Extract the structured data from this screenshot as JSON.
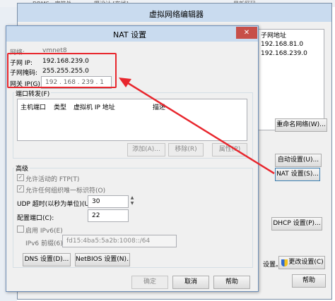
{
  "taskbar": {
    "items": [
      "DRMS - 字符处",
      "摄设计 [在线]",
      "最新区码"
    ]
  },
  "back_window": {
    "title": "虚拟网络编辑器",
    "col_subnet": "子网地址",
    "rows": [
      "192.168.81.0",
      "192.168.239.0"
    ],
    "rename_btn": "重命名网络(W)...",
    "auto_btn": "自动设置(U)...",
    "nat_btn": "NAT 设置(S)...",
    "dhcp_btn": "DHCP 设置(P)...",
    "change_btn": "更改设置(C)",
    "partial_text": "设置。",
    "help_btn": "帮助"
  },
  "nat": {
    "title": "NAT 设置",
    "close_glyph": "✕",
    "network_label": "网络:",
    "network_value": "vmnet8",
    "subnet_ip_label": "子网 IP:",
    "subnet_ip_value": "192.168.239.0",
    "subnet_mask_label": "子网掩码:",
    "subnet_mask_value": "255.255.255.0",
    "gateway_label": "网关 IP(G):",
    "gateway_value": "192 . 168 . 239 . 1",
    "port_forward": {
      "group_label": "端口转发(F)",
      "columns": [
        "主机端口",
        "类型",
        "虚拟机 IP 地址",
        "描述"
      ],
      "add_btn": "添加(A)...",
      "remove_btn": "移除(R)",
      "props_btn": "属性(P)"
    },
    "advanced": {
      "group_label": "高级",
      "ftp_label": "允许活动的 FTP(T)",
      "uuid_label": "允许任何组织唯一标识符(O)",
      "udp_label": "UDP 超时(以秒为单位)(U):",
      "udp_value": "30",
      "config_port_label": "配置端口(C):",
      "config_port_value": "22",
      "ipv6_label": "启用 IPv6(E)",
      "ipv6_prefix_label": "IPv6 前缀(6):",
      "ipv6_prefix_value": "fd15:4ba5:5a2b:1008::/64",
      "dns_btn": "DNS 设置(D)...",
      "netbios_btn": "NetBIOS 设置(N)..."
    },
    "ok_btn": "确定",
    "cancel_btn": "取消",
    "help_btn": "帮助"
  },
  "colors": {
    "highlight_red": "#e8262d",
    "dialog_bg": "#f0f0f0",
    "titlebar": "#c9dbef",
    "close_red": "#c74f49"
  }
}
